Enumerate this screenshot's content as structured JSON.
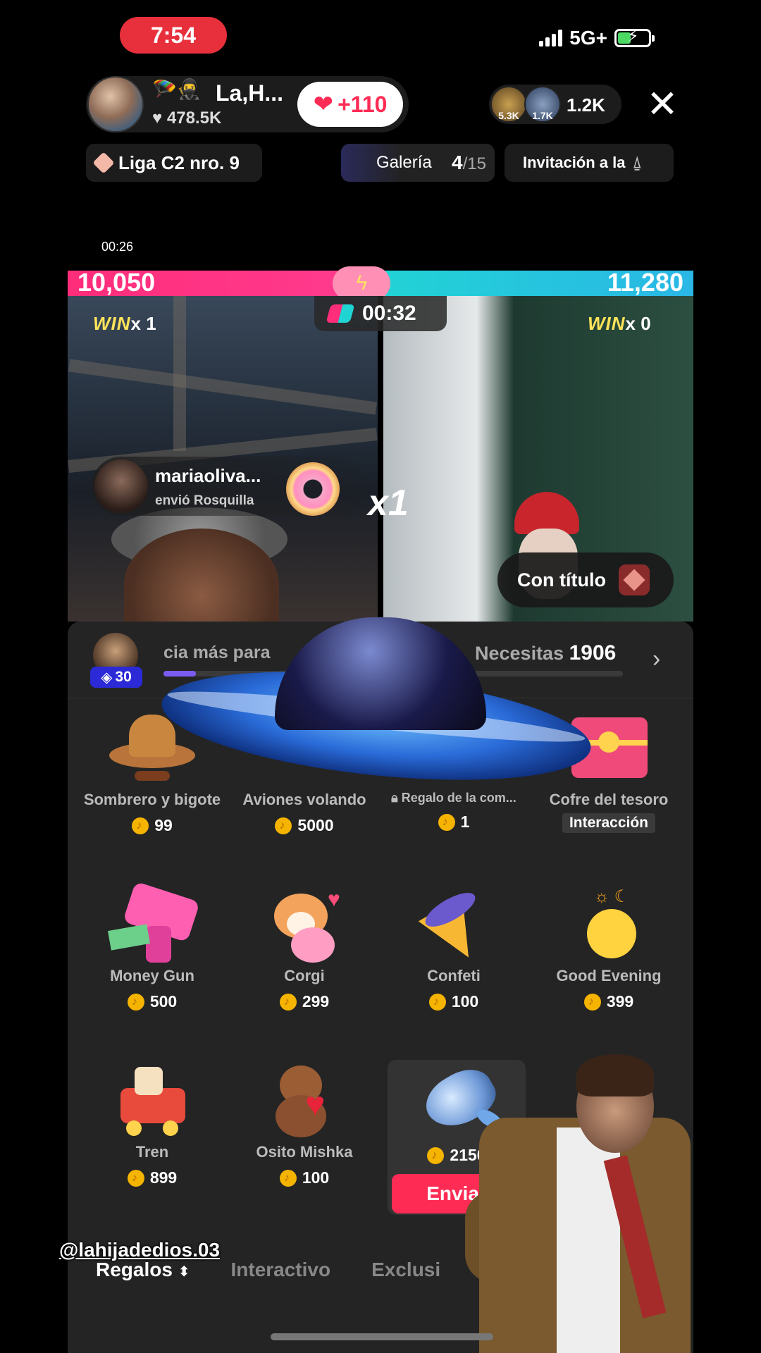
{
  "status_bar": {
    "time": "7:54",
    "network": "5G+"
  },
  "host": {
    "name": "La,H...",
    "likes": "478.5K",
    "like_button": "+110"
  },
  "viewers": {
    "avatar_1_count": "5.3K",
    "avatar_2_count": "1.7K",
    "total": "1.2K"
  },
  "league": {
    "label": "Liga C2 nro. 9"
  },
  "gallery": {
    "label": "Galería",
    "current": "4",
    "total": "/15"
  },
  "invite": {
    "label": "Invitación a la"
  },
  "stream_timer": "00:26",
  "battle": {
    "score_left": "10,050",
    "score_right": "11,280",
    "timer": "00:32",
    "left_win_word": "WIN",
    "left_win_count": "x 1",
    "right_win_word": "WIN",
    "right_win_count": "x 0",
    "left_share": 0.47
  },
  "gift_notice": {
    "user": "mariaoliva...",
    "action": "envió Rosquilla",
    "multiplier": "x1"
  },
  "title_badge": {
    "label": "Con título"
  },
  "gift_panel": {
    "level_badge": "30",
    "progress_text": "cia más para",
    "need_label": "Necesitas",
    "need_value": "1906",
    "progress_fraction": 0.07,
    "gifts": [
      {
        "name": "Sombrero y bigote",
        "price": "99",
        "icon": "cowboy-hat-icon"
      },
      {
        "name": "Aviones volando",
        "price": "5000",
        "icon": "planes-icon"
      },
      {
        "name": "Regalo de la com...",
        "price": "1",
        "icon": "lock-icon"
      },
      {
        "name": "Cofre del tesoro",
        "price": "Interacción",
        "icon": "treasure-chest-icon"
      },
      {
        "name": "Money Gun",
        "price": "500",
        "icon": "money-gun-icon"
      },
      {
        "name": "Corgi",
        "price": "299",
        "icon": "corgi-icon"
      },
      {
        "name": "Confeti",
        "price": "100",
        "icon": "confetti-icon"
      },
      {
        "name": "Good Evening",
        "price": "399",
        "icon": "good-evening-icon"
      },
      {
        "name": "Tren",
        "price": "899",
        "icon": "train-icon"
      },
      {
        "name": "Osito Mishka",
        "price": "100",
        "icon": "teddy-bear-icon"
      },
      {
        "name": "",
        "price": "2150",
        "icon": "whale-icon"
      }
    ],
    "send_label": "Enviar"
  },
  "tabs": {
    "gifts": "Regalos",
    "interactive": "Interactivo",
    "exclusive": "Exclusi"
  },
  "watermark": "@lahijadedios.03",
  "colors": {
    "accent_pink": "#fe2c55",
    "battle_left": "#ff2d7a",
    "battle_right": "#21d4d4",
    "panel_bg": "#242424"
  }
}
